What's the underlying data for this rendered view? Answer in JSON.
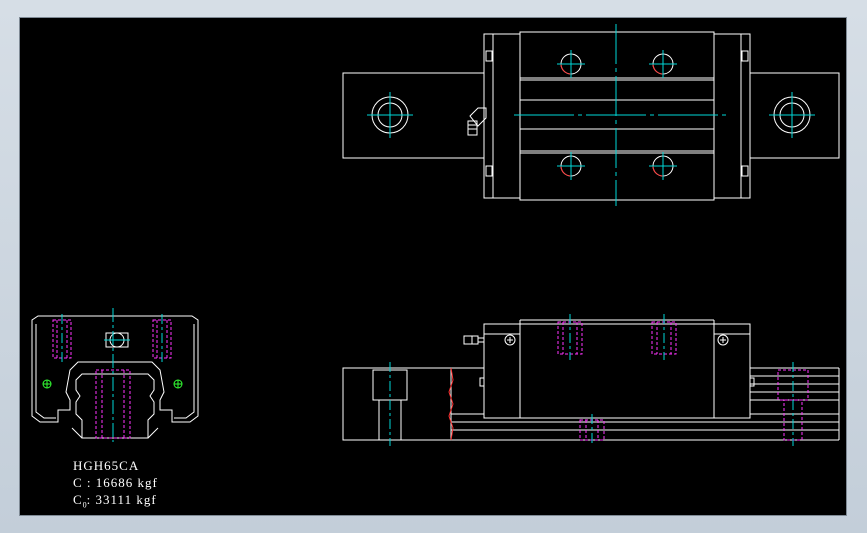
{
  "drawing": {
    "model": "HGH65CA",
    "dynamic_load": "C : 16686 kgf",
    "static_load_prefix": "C",
    "static_load_subscript": "0",
    "static_load_value": ": 33111 kgf"
  },
  "colors": {
    "background": "#000000",
    "outline": "#ffffff",
    "centerline": "#00d8d8",
    "hidden": "#ff33ff",
    "section": "#ff3333",
    "fitting": "#33ff33",
    "grease": "#ffff66"
  },
  "views": [
    "top-view",
    "end-view",
    "side-view"
  ]
}
